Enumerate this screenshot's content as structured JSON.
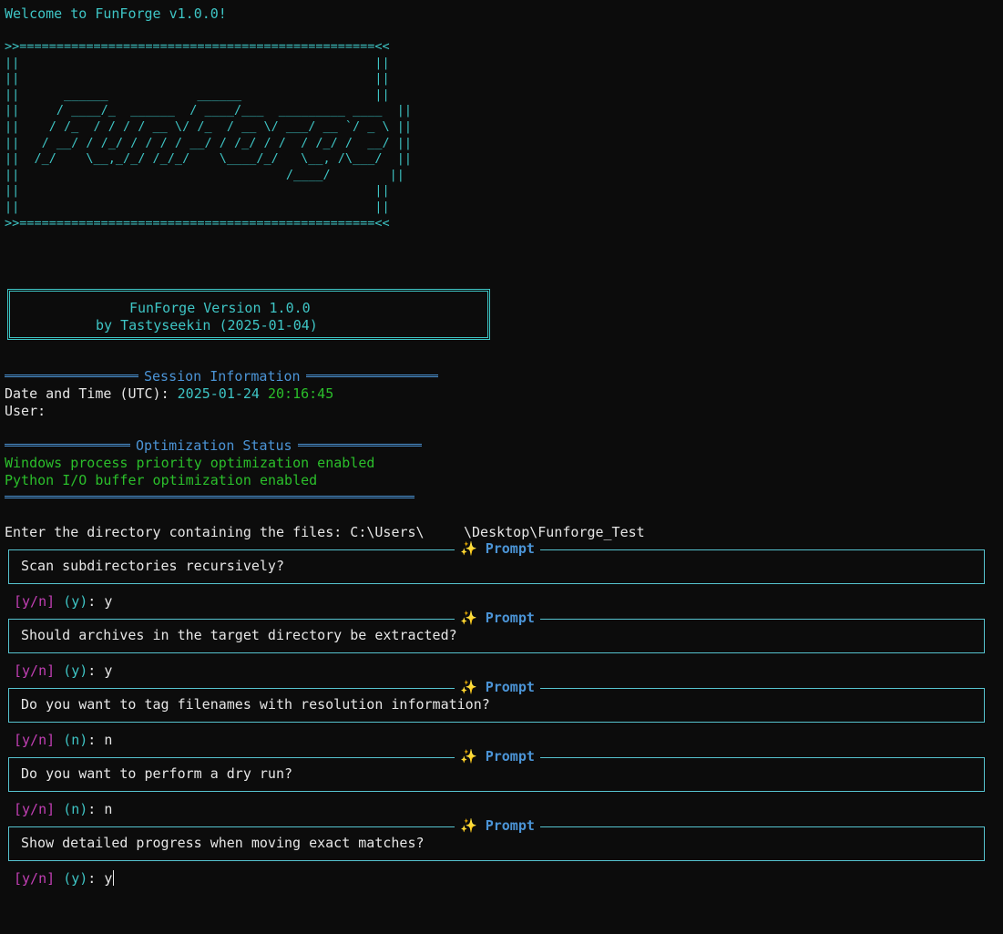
{
  "welcome": "Welcome to FunForge v1.0.0!",
  "ascii_frame": ">>================================================<<\n||                                                ||\n||                                                ||\n||      ______            ______                  ||\n||     / ____/_  ______  / ____/___  _________ ____  ||\n||    / /_  / / / / __ \\/ /_  / __ \\/ ___/ __ `/ _ \\ ||\n||   / __/ / /_/ / / / / __/ / /_/ / /  / /_/ /  __/ ||\n||  /_/    \\__,_/_/ /_/_/    \\____/_/   \\__, /\\___/  ||\n||                                    /____/        ||\n||                                                ||\n||                                                ||\n>>================================================<<",
  "version_box": {
    "line1": "FunForge Version 1.0.0",
    "line2": "by Tastyseekin (2025-01-04)"
  },
  "session": {
    "title": "Session Information",
    "datetime_label": "Date and Time (UTC): ",
    "date": "2025-01-24",
    "time": "20:16:45",
    "user_label": "User:"
  },
  "optimization": {
    "title": "Optimization Status",
    "line1": "Windows process priority optimization enabled",
    "line2": "Python I/O buffer optimization enabled"
  },
  "directory": {
    "prompt": "Enter the directory containing the files: ",
    "path_start": "C:\\Users\\",
    "path_end": "\\Desktop\\Funforge_Test"
  },
  "prompt_title": "Prompt",
  "prompts": [
    {
      "question": "Scan subdirectories recursively?",
      "options": "[y/n]",
      "default": "(y)",
      "answer": "y"
    },
    {
      "question": "Should archives in the target directory be extracted?",
      "options": "[y/n]",
      "default": "(y)",
      "answer": "y"
    },
    {
      "question": "Do you want to tag filenames with resolution information?",
      "options": "[y/n]",
      "default": "(n)",
      "answer": "n"
    },
    {
      "question": "Do you want to perform a dry run?",
      "options": "[y/n]",
      "default": "(n)",
      "answer": "n"
    },
    {
      "question": "Show detailed progress when moving exact matches?",
      "options": "[y/n]",
      "default": "(y)",
      "answer": "y"
    }
  ],
  "colors": {
    "background": "#0c0c0c",
    "cyan": "#3ec5c5",
    "green": "#2bbf2b",
    "blue": "#4b94d6",
    "magenta": "#c33fb5"
  }
}
